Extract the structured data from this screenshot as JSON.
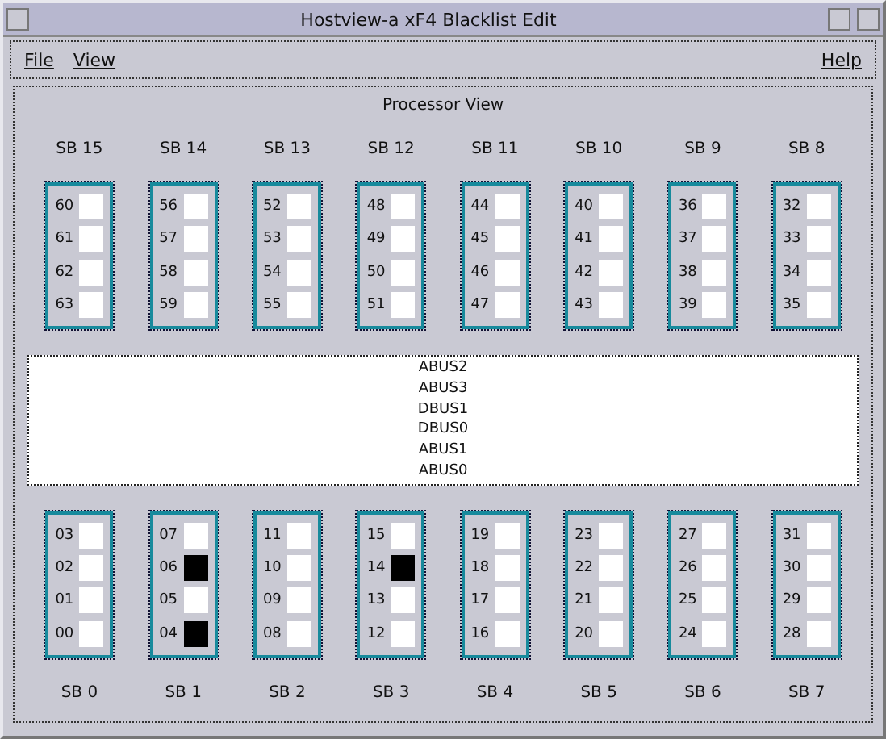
{
  "window": {
    "title": "Hostview-a xF4 Blacklist Edit"
  },
  "menu": {
    "left": [
      "File",
      "View"
    ],
    "right": [
      "Help"
    ]
  },
  "panel_title": "Processor View",
  "top_boards": [
    {
      "label": "SB 15",
      "cpus": [
        {
          "id": "60",
          "selected": false
        },
        {
          "id": "61",
          "selected": false
        },
        {
          "id": "62",
          "selected": false
        },
        {
          "id": "63",
          "selected": false
        }
      ]
    },
    {
      "label": "SB 14",
      "cpus": [
        {
          "id": "56",
          "selected": false
        },
        {
          "id": "57",
          "selected": false
        },
        {
          "id": "58",
          "selected": false
        },
        {
          "id": "59",
          "selected": false
        }
      ]
    },
    {
      "label": "SB 13",
      "cpus": [
        {
          "id": "52",
          "selected": false
        },
        {
          "id": "53",
          "selected": false
        },
        {
          "id": "54",
          "selected": false
        },
        {
          "id": "55",
          "selected": false
        }
      ]
    },
    {
      "label": "SB 12",
      "cpus": [
        {
          "id": "48",
          "selected": false
        },
        {
          "id": "49",
          "selected": false
        },
        {
          "id": "50",
          "selected": false
        },
        {
          "id": "51",
          "selected": false
        }
      ]
    },
    {
      "label": "SB 11",
      "cpus": [
        {
          "id": "44",
          "selected": false
        },
        {
          "id": "45",
          "selected": false
        },
        {
          "id": "46",
          "selected": false
        },
        {
          "id": "47",
          "selected": false
        }
      ]
    },
    {
      "label": "SB 10",
      "cpus": [
        {
          "id": "40",
          "selected": false
        },
        {
          "id": "41",
          "selected": false
        },
        {
          "id": "42",
          "selected": false
        },
        {
          "id": "43",
          "selected": false
        }
      ]
    },
    {
      "label": "SB 9",
      "cpus": [
        {
          "id": "36",
          "selected": false
        },
        {
          "id": "37",
          "selected": false
        },
        {
          "id": "38",
          "selected": false
        },
        {
          "id": "39",
          "selected": false
        }
      ]
    },
    {
      "label": "SB 8",
      "cpus": [
        {
          "id": "32",
          "selected": false
        },
        {
          "id": "33",
          "selected": false
        },
        {
          "id": "34",
          "selected": false
        },
        {
          "id": "35",
          "selected": false
        }
      ]
    }
  ],
  "buses": [
    "ABUS2",
    "ABUS3",
    "DBUS1",
    "DBUS0",
    "ABUS1",
    "ABUS0"
  ],
  "bottom_boards": [
    {
      "label": "SB 0",
      "cpus": [
        {
          "id": "03",
          "selected": false
        },
        {
          "id": "02",
          "selected": false
        },
        {
          "id": "01",
          "selected": false
        },
        {
          "id": "00",
          "selected": false
        }
      ]
    },
    {
      "label": "SB 1",
      "cpus": [
        {
          "id": "07",
          "selected": false
        },
        {
          "id": "06",
          "selected": true
        },
        {
          "id": "05",
          "selected": false
        },
        {
          "id": "04",
          "selected": true
        }
      ]
    },
    {
      "label": "SB 2",
      "cpus": [
        {
          "id": "11",
          "selected": false
        },
        {
          "id": "10",
          "selected": false
        },
        {
          "id": "09",
          "selected": false
        },
        {
          "id": "08",
          "selected": false
        }
      ]
    },
    {
      "label": "SB 3",
      "cpus": [
        {
          "id": "15",
          "selected": false
        },
        {
          "id": "14",
          "selected": true
        },
        {
          "id": "13",
          "selected": false
        },
        {
          "id": "12",
          "selected": false
        }
      ]
    },
    {
      "label": "SB 4",
      "cpus": [
        {
          "id": "19",
          "selected": false
        },
        {
          "id": "18",
          "selected": false
        },
        {
          "id": "17",
          "selected": false
        },
        {
          "id": "16",
          "selected": false
        }
      ]
    },
    {
      "label": "SB 5",
      "cpus": [
        {
          "id": "23",
          "selected": false
        },
        {
          "id": "22",
          "selected": false
        },
        {
          "id": "21",
          "selected": false
        },
        {
          "id": "20",
          "selected": false
        }
      ]
    },
    {
      "label": "SB 6",
      "cpus": [
        {
          "id": "27",
          "selected": false
        },
        {
          "id": "26",
          "selected": false
        },
        {
          "id": "25",
          "selected": false
        },
        {
          "id": "24",
          "selected": false
        }
      ]
    },
    {
      "label": "SB 7",
      "cpus": [
        {
          "id": "31",
          "selected": false
        },
        {
          "id": "30",
          "selected": false
        },
        {
          "id": "29",
          "selected": false
        },
        {
          "id": "28",
          "selected": false
        }
      ]
    }
  ]
}
